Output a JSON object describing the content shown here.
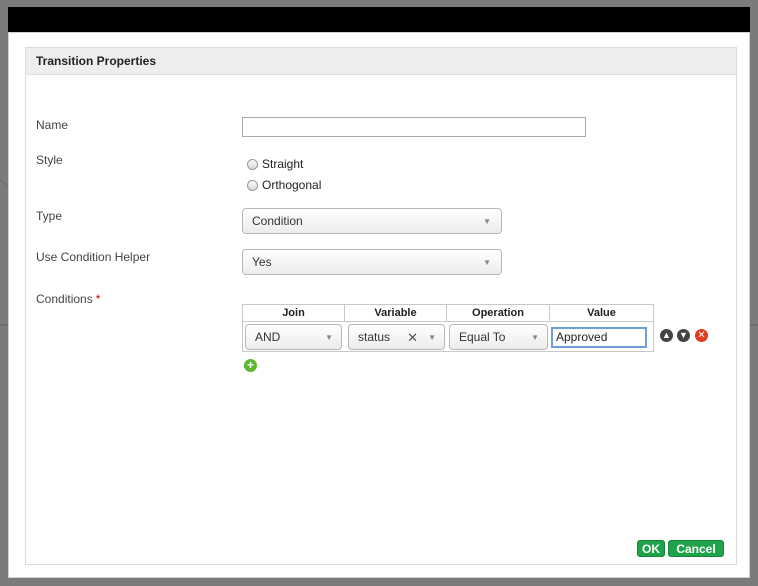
{
  "dialog": {
    "title": "Transition Properties"
  },
  "form": {
    "name_label": "Name",
    "name_value": "",
    "style_label": "Style",
    "style_options": [
      "Straight",
      "Orthogonal"
    ],
    "type_label": "Type",
    "type_value": "Condition",
    "helper_label": "Use Condition Helper",
    "helper_value": "Yes",
    "conditions_label": "Conditions",
    "required_mark": "*"
  },
  "conditions": {
    "headers": [
      "Join",
      "Variable",
      "Operation",
      "Value"
    ],
    "row": {
      "join": "AND",
      "variable": "status",
      "operation": "Equal To",
      "value": "Approved"
    }
  },
  "icons": {
    "move_up": "arrow-up-circle-icon",
    "move_down": "arrow-down-circle-icon",
    "remove": "remove-circle-icon",
    "add": "add-circle-icon",
    "clear": "clear-x-icon",
    "dropdown": "chevron-down-icon"
  },
  "colors": {
    "accent_green": "#1ea34a",
    "remove_red": "#e03c1f",
    "icon_gray": "#444444",
    "add_green": "#5cb82c"
  },
  "footer": {
    "ok_label": "OK",
    "cancel_label": "Cancel"
  }
}
